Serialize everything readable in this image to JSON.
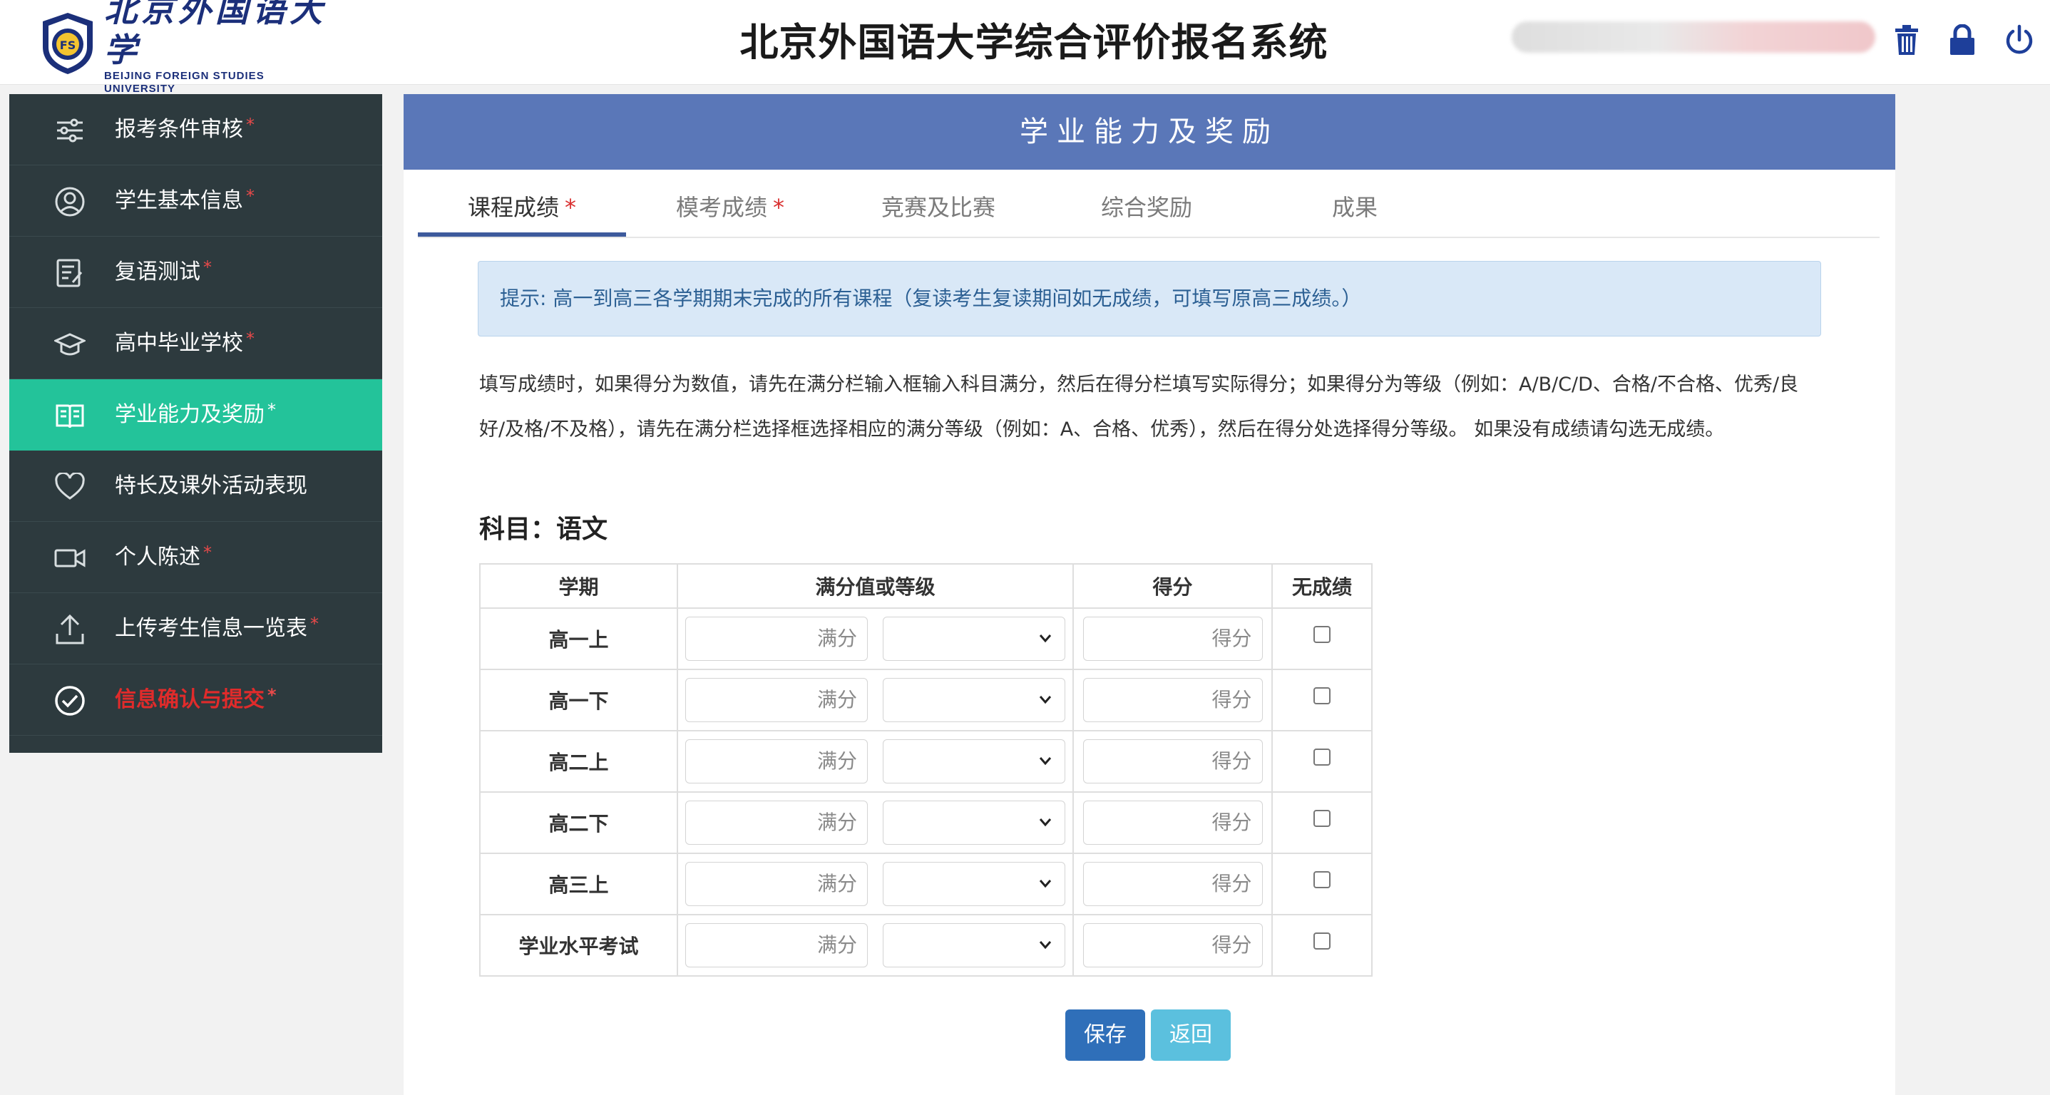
{
  "header": {
    "logo_cn": "北京外国语大学",
    "logo_en": "BEIJING FOREIGN STUDIES UNIVERSITY",
    "title": "北京外国语大学综合评价报名系统",
    "icons": [
      "trash-icon",
      "lock-icon",
      "power-icon"
    ]
  },
  "sidebar": {
    "items": [
      {
        "label": "报考条件审核",
        "required": "*",
        "icon": "sliders-icon"
      },
      {
        "label": "学生基本信息",
        "required": "*",
        "icon": "user-icon"
      },
      {
        "label": "复语测试",
        "required": "*",
        "icon": "edit-doc-icon"
      },
      {
        "label": "高中毕业学校",
        "required": "*",
        "icon": "graduation-cap-icon"
      },
      {
        "label": "学业能力及奖励",
        "required": "*",
        "icon": "book-icon",
        "active": true
      },
      {
        "label": "特长及课外活动表现",
        "required": "",
        "icon": "heart-icon"
      },
      {
        "label": "个人陈述",
        "required": "*",
        "icon": "video-icon"
      },
      {
        "label": "上传考生信息一览表",
        "required": "*",
        "icon": "upload-icon"
      },
      {
        "label": "信息确认与提交",
        "required": "*",
        "icon": "check-circle-icon"
      }
    ]
  },
  "main": {
    "title": "学业能力及奖励",
    "tabs": [
      {
        "label": "课程成绩",
        "star": "*",
        "active": true
      },
      {
        "label": "模考成绩",
        "star": "*"
      },
      {
        "label": "竞赛及比赛",
        "star": ""
      },
      {
        "label": "综合奖励",
        "star": ""
      },
      {
        "label": "成果",
        "star": ""
      }
    ],
    "notice": "提示: 高一到高三各学期期末完成的所有课程（复读考生复读期间如无成绩，可填写原高三成绩。）",
    "description": "填写成绩时，如果得分为数值，请先在满分栏输入框输入科目满分，然后在得分栏填写实际得分；如果得分为等级（例如：A/B/C/D、合格/不合格、优秀/良好/及格/不及格），请先在满分栏选择框选择相应的满分等级（例如：A、合格、优秀），然后在得分处选择得分等级。 如果没有成绩请勾选无成绩。",
    "subject": "科目：语文",
    "table": {
      "headers": [
        "学期",
        "满分值或等级",
        "得分",
        "无成绩"
      ],
      "full_placeholder": "满分",
      "score_placeholder": "得分",
      "rows": [
        {
          "term": "高一上"
        },
        {
          "term": "高一下"
        },
        {
          "term": "高二上"
        },
        {
          "term": "高二下"
        },
        {
          "term": "高三上"
        },
        {
          "term": "学业水平考试"
        }
      ]
    },
    "buttons": {
      "save": "保存",
      "back": "返回"
    }
  },
  "colors": {
    "sidebar_bg": "#2d3a3e",
    "sidebar_active": "#23c39a",
    "header_bar": "#5a77b8",
    "save_button": "#2f6fb9",
    "back_button": "#5bc0de"
  }
}
